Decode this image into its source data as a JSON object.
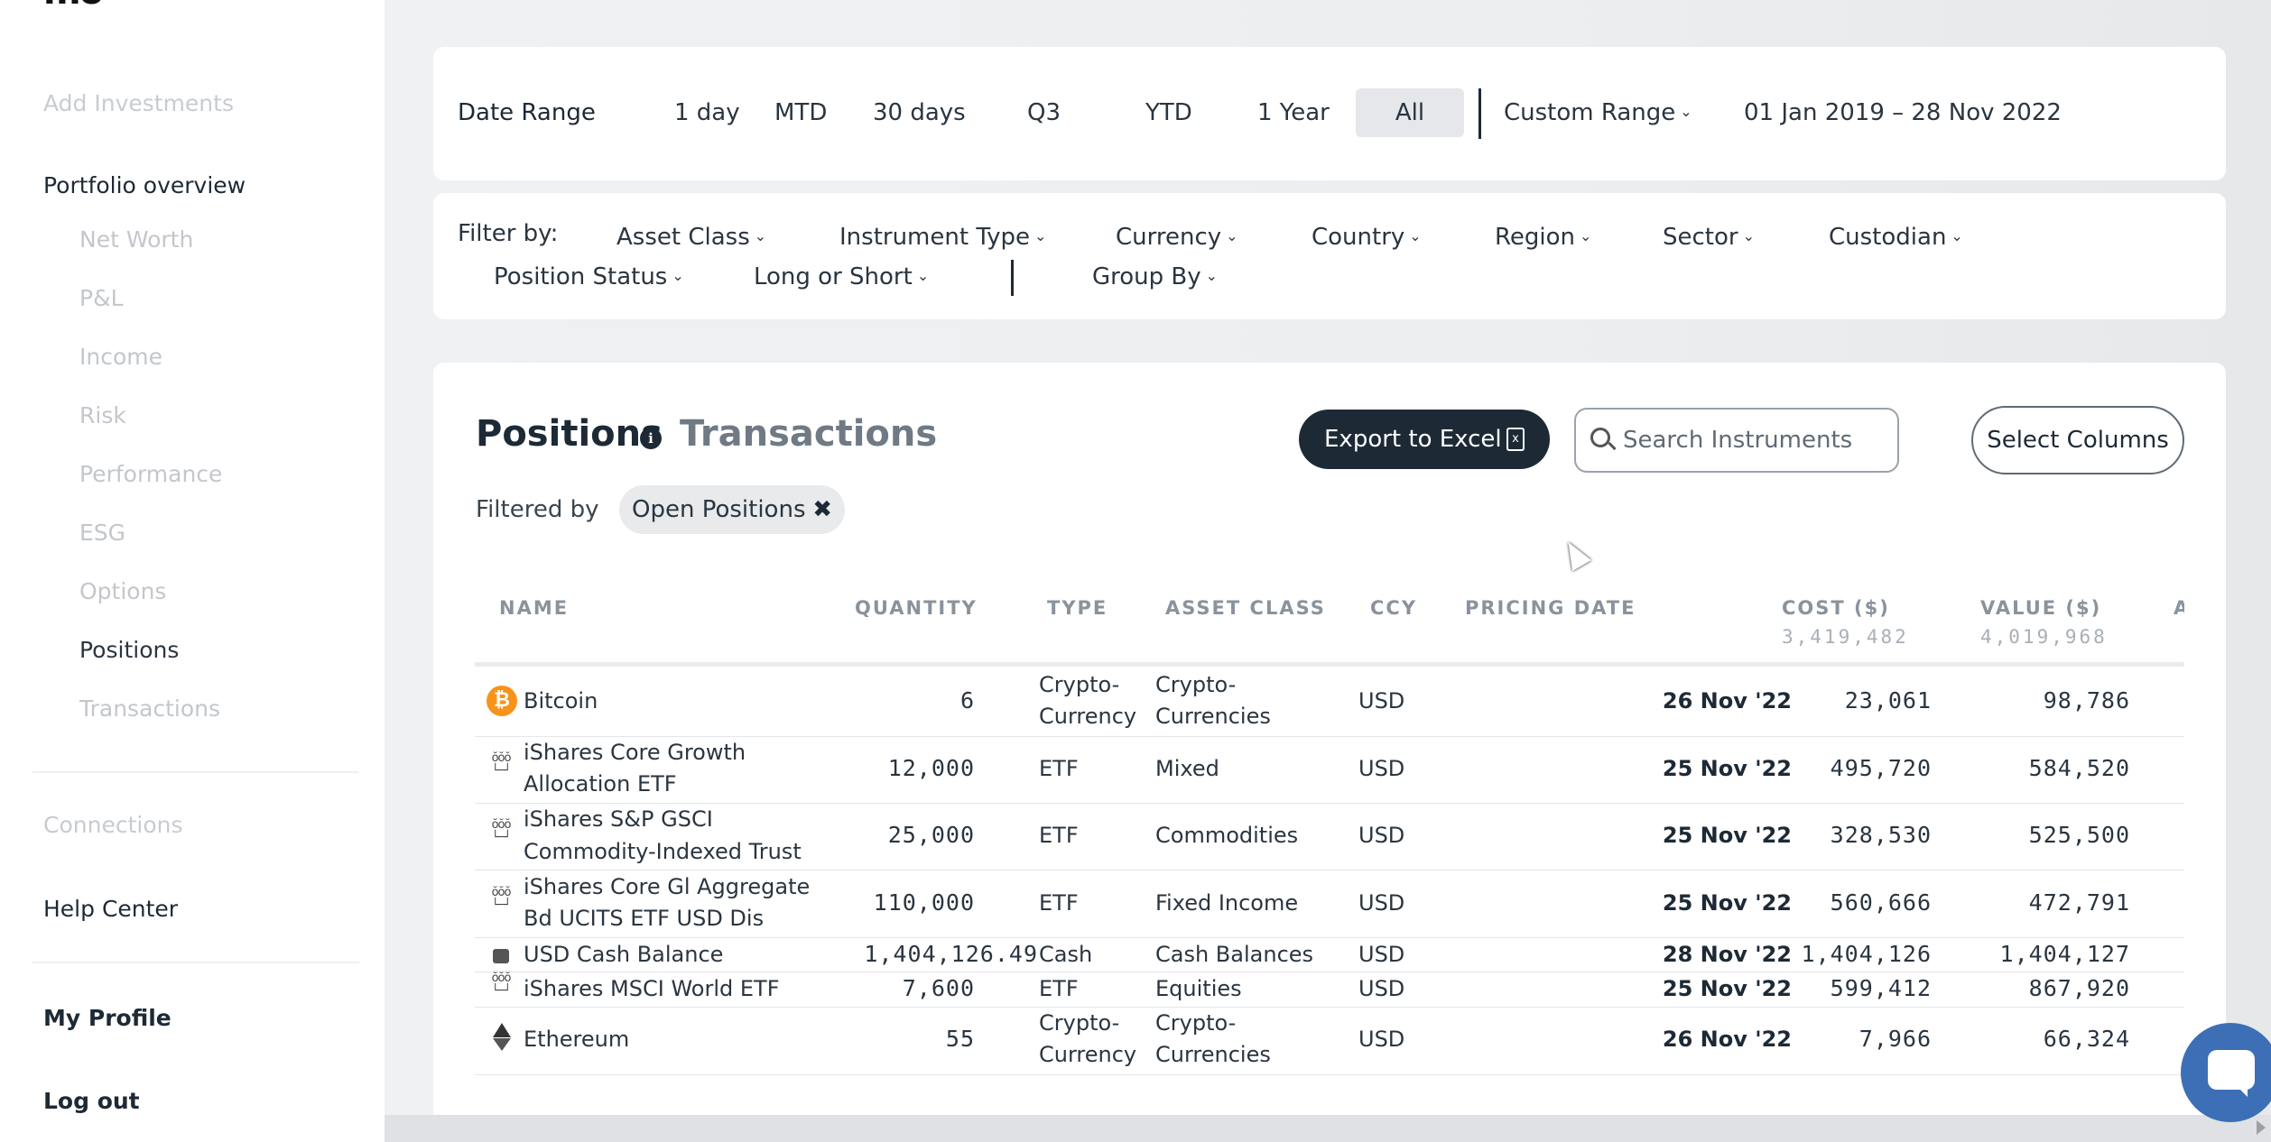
{
  "sidebar": {
    "logo": "mo",
    "add_investments": "Add Investments",
    "portfolio_overview": "Portfolio overview",
    "items": [
      {
        "label": "Net Worth"
      },
      {
        "label": "P&L"
      },
      {
        "label": "Income"
      },
      {
        "label": "Risk"
      },
      {
        "label": "Performance"
      },
      {
        "label": "ESG"
      },
      {
        "label": "Options"
      },
      {
        "label": "Positions"
      },
      {
        "label": "Transactions"
      }
    ],
    "connections": "Connections",
    "help_center": "Help Center",
    "my_profile": "My Profile",
    "log_out": "Log out"
  },
  "date_range": {
    "label": "Date Range",
    "options": [
      "1 day",
      "MTD",
      "30 days",
      "Q3",
      "YTD",
      "1 Year",
      "All"
    ],
    "selected": "All",
    "custom": "Custom Range",
    "range_text": "01 Jan 2019 – 28 Nov 2022"
  },
  "filters": {
    "label": "Filter by:",
    "items": [
      "Asset Class",
      "Instrument Type",
      "Currency",
      "Country",
      "Region",
      "Sector",
      "Custodian",
      "Position Status",
      "Long or Short",
      "Group By"
    ]
  },
  "positions": {
    "tab_positions": "Positions",
    "tab_transactions": "Transactions",
    "info_icon": "i",
    "export_label": "Export to Excel",
    "search_placeholder": "Search Instruments",
    "select_columns": "Select Columns",
    "filtered_by": "Filtered by",
    "chip_label": "Open Positions",
    "chip_close": "✖",
    "columns": {
      "name": "NAME",
      "quantity": "QUANTITY",
      "type": "TYPE",
      "asset_class": "ASSET CLASS",
      "ccy": "CCY",
      "pricing_date": "PRICING DATE",
      "cost": "COST ($)",
      "cost_total": "3,419,482",
      "value": "VALUE ($)",
      "value_total": "4,019,968",
      "next": "A"
    },
    "rows": [
      {
        "icon": "bitcoin-icon",
        "name_1": "Bitcoin",
        "name_2": "",
        "quantity": "6",
        "type_1": "Crypto-",
        "type_2": "Currency",
        "asset_1": "Crypto-",
        "asset_2": "Currencies",
        "ccy": "USD",
        "pricing_date": "26 Nov '22",
        "cost": "23,061",
        "value": "98,786"
      },
      {
        "icon": "etf-icon",
        "name_1": "iShares Core Growth",
        "name_2": "Allocation ETF",
        "quantity": "12,000",
        "type_1": "ETF",
        "type_2": "",
        "asset_1": "Mixed",
        "asset_2": "",
        "ccy": "USD",
        "pricing_date": "25 Nov '22",
        "cost": "495,720",
        "value": "584,520"
      },
      {
        "icon": "etf-icon",
        "name_1": "iShares S&P GSCI",
        "name_2": "Commodity-Indexed Trust",
        "quantity": "25,000",
        "type_1": "ETF",
        "type_2": "",
        "asset_1": "Commodities",
        "asset_2": "",
        "ccy": "USD",
        "pricing_date": "25 Nov '22",
        "cost": "328,530",
        "value": "525,500"
      },
      {
        "icon": "etf-icon",
        "name_1": "iShares Core Gl Aggregate",
        "name_2": "Bd UCITS ETF USD Dis",
        "quantity": "110,000",
        "type_1": "ETF",
        "type_2": "",
        "asset_1": "Fixed Income",
        "asset_2": "",
        "ccy": "USD",
        "pricing_date": "25 Nov '22",
        "cost": "560,666",
        "value": "472,791"
      },
      {
        "icon": "cash-icon",
        "name_1": "USD Cash Balance",
        "name_2": "",
        "quantity": "1,404,126.49",
        "type_1": "Cash",
        "type_2": "",
        "asset_1": "Cash Balances",
        "asset_2": "",
        "ccy": "USD",
        "pricing_date": "28 Nov '22",
        "cost": "1,404,126",
        "value": "1,404,127"
      },
      {
        "icon": "etf-icon",
        "name_1": "iShares MSCI World ETF",
        "name_2": "",
        "quantity": "7,600",
        "type_1": "ETF",
        "type_2": "",
        "asset_1": "Equities",
        "asset_2": "",
        "ccy": "USD",
        "pricing_date": "25 Nov '22",
        "cost": "599,412",
        "value": "867,920"
      },
      {
        "icon": "ethereum-icon",
        "name_1": "Ethereum",
        "name_2": "",
        "quantity": "55",
        "type_1": "Crypto-",
        "type_2": "Currency",
        "asset_1": "Crypto-",
        "asset_2": "Currencies",
        "ccy": "USD",
        "pricing_date": "26 Nov '22",
        "cost": "7,966",
        "value": "66,324"
      }
    ]
  },
  "colors": {
    "primary": "#1d2a36",
    "bitcoin": "#f7931a",
    "chat": "#3d6fb6"
  }
}
